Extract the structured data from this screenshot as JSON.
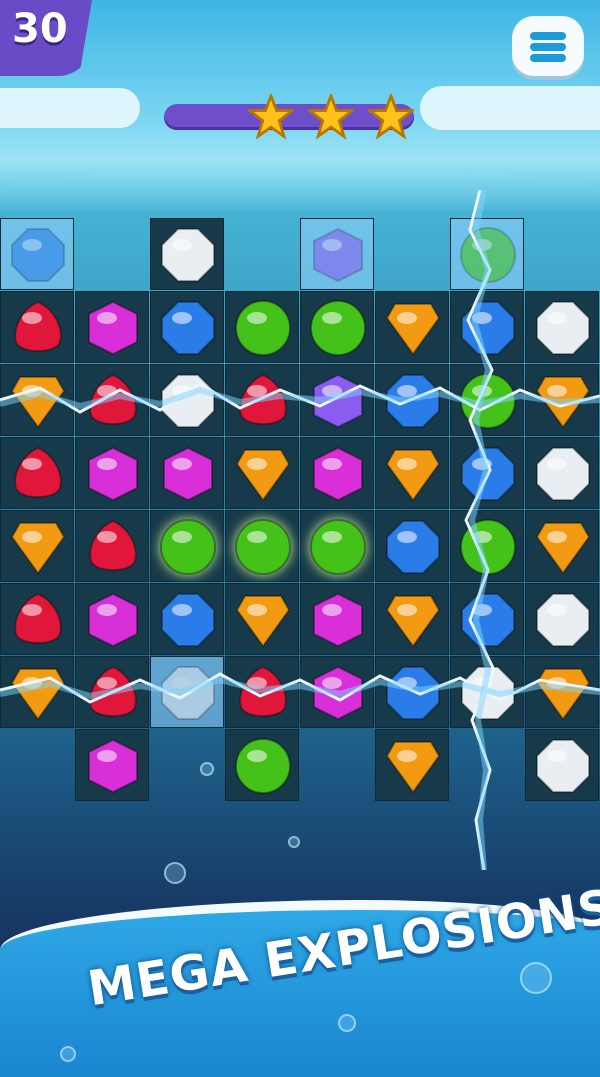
{
  "hud": {
    "moves_left": "30",
    "stars_earned": 3,
    "stars_total": 3
  },
  "menu": {
    "icon": "hamburger-menu-icon"
  },
  "board": {
    "rows": [
      [
        "ice-blue-diamond",
        "empty",
        "white",
        "empty",
        "ice-purple",
        "empty",
        "ice-green",
        "empty"
      ],
      [
        "red",
        "magenta",
        "blue",
        "green",
        "green",
        "orange",
        "blue",
        "white"
      ],
      [
        "orange",
        "red",
        "white",
        "red",
        "purple-special",
        "blue",
        "green",
        "orange"
      ],
      [
        "red",
        "magenta",
        "magenta",
        "orange",
        "magenta",
        "orange",
        "blue-swirl",
        "white"
      ],
      [
        "orange",
        "red",
        "green-glow",
        "green-glow",
        "green-glow",
        "blue",
        "green",
        "orange"
      ],
      [
        "red",
        "magenta",
        "blue",
        "orange",
        "magenta",
        "orange",
        "blue",
        "white"
      ],
      [
        "orange",
        "red",
        "ice-white",
        "red",
        "magenta",
        "blue",
        "white-swirl",
        "orange"
      ],
      [
        "none",
        "magenta",
        "none",
        "green",
        "none",
        "orange",
        "none",
        "white"
      ]
    ],
    "colors": {
      "red": "#e0173a",
      "magenta": "#d82fd8",
      "blue": "#2a7de8",
      "green": "#44c21a",
      "orange": "#f29a12",
      "white": "#e8eef2",
      "purple": "#8b5cf0"
    }
  },
  "tagline": "MEGA EXPLOSIONS!"
}
